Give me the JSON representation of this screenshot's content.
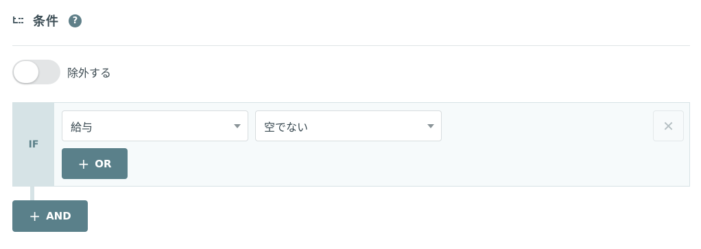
{
  "header": {
    "icon": "tree-structure-icon",
    "title": "条件",
    "help_icon": "?"
  },
  "exclude_toggle": {
    "label": "除外する",
    "on": false
  },
  "condition": {
    "if_label": "IF",
    "field_select": {
      "value": "給与"
    },
    "operator_select": {
      "value": "空でない"
    },
    "remove_icon": "✕",
    "or_button": {
      "icon": "+",
      "label": "OR"
    }
  },
  "and_button": {
    "icon": "+",
    "label": "AND"
  },
  "colors": {
    "accent": "#5a808a",
    "if_bg": "#d6e3e6",
    "block_bg": "#f6fafb"
  }
}
